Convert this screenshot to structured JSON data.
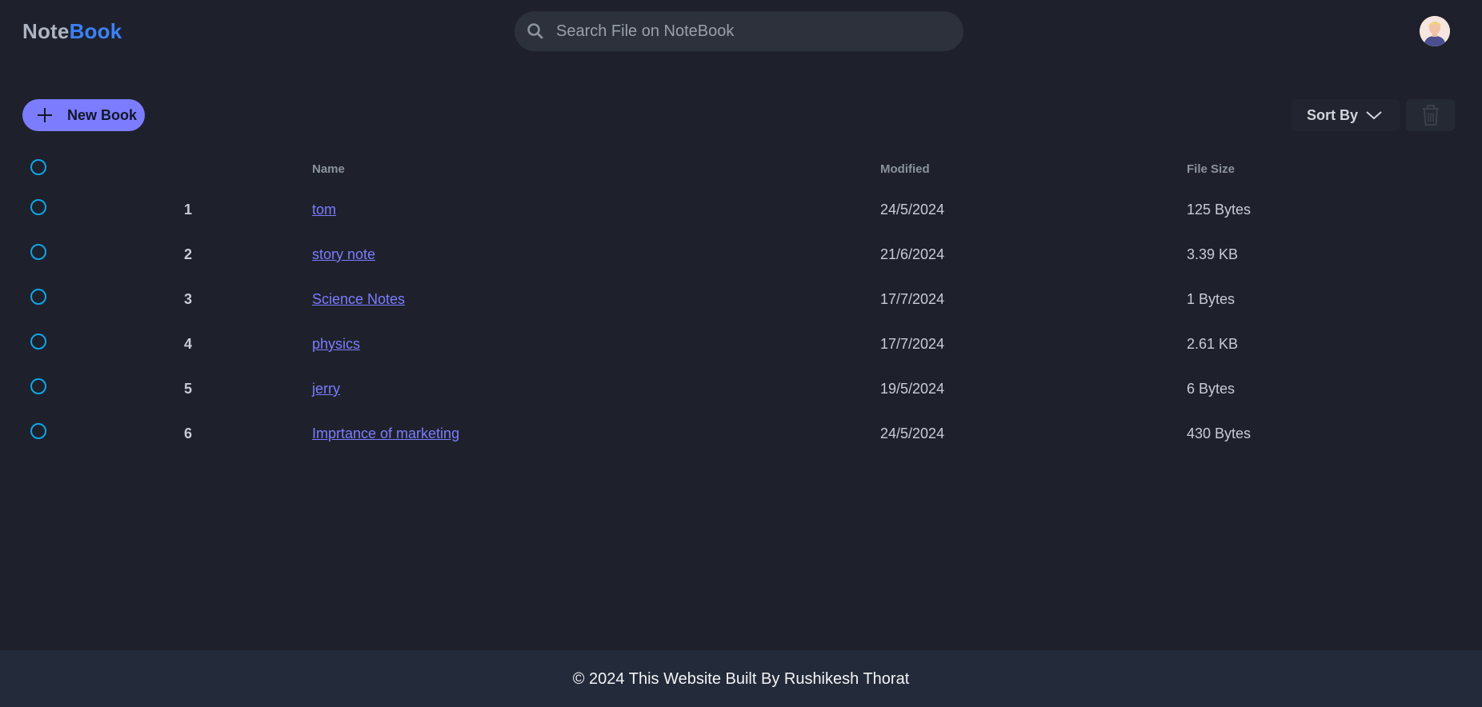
{
  "app": {
    "logo_part1": "Note",
    "logo_part2": "Book"
  },
  "search": {
    "placeholder": "Search File on NoteBook",
    "value": ""
  },
  "toolbar": {
    "new_book_label": "New Book",
    "sort_label": "Sort By"
  },
  "table": {
    "columns": {
      "name": "Name",
      "modified": "Modified",
      "size": "File Size"
    },
    "rows": [
      {
        "num": "1",
        "name": "tom",
        "modified": "24/5/2024",
        "size": "125 Bytes"
      },
      {
        "num": "2",
        "name": "story note",
        "modified": "21/6/2024",
        "size": "3.39 KB"
      },
      {
        "num": "3",
        "name": "Science Notes",
        "modified": "17/7/2024",
        "size": "1 Bytes"
      },
      {
        "num": "4",
        "name": "physics",
        "modified": "17/7/2024",
        "size": "2.61 KB"
      },
      {
        "num": "5",
        "name": "jerry",
        "modified": "19/5/2024",
        "size": "6 Bytes"
      },
      {
        "num": "6",
        "name": "Imprtance of marketing",
        "modified": "24/5/2024",
        "size": "430 Bytes"
      }
    ]
  },
  "footer": {
    "text": "© 2024 This Website Built By Rushikesh Thorat"
  },
  "colors": {
    "background": "#1e212b",
    "accent": "#7c7cff",
    "logo_accent": "#3b82f6",
    "radio": "#0ea5e9",
    "footer_bg": "#232a39"
  },
  "icons": {
    "search": "search-icon",
    "avatar": "avatar",
    "plus": "plus-icon",
    "sort": "chevron-down-icon",
    "delete": "trash-icon"
  }
}
